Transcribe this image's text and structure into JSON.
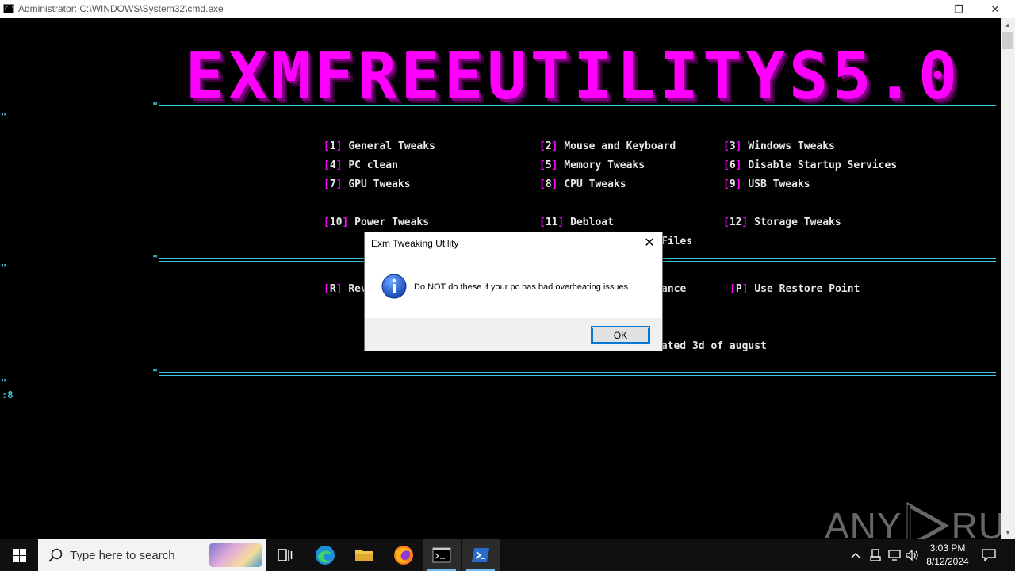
{
  "window": {
    "title": "Administrator: C:\\WINDOWS\\System32\\cmd.exe",
    "icon": "cmd-icon",
    "controls": {
      "minimize": "–",
      "restore": "❐",
      "close": "✕"
    }
  },
  "console": {
    "banner": "EXMFREEUTILITYS5.0",
    "ticks": [
      "\"",
      "\"",
      "\"",
      "\"",
      "\"",
      "\"",
      "\""
    ],
    "rows": [
      [
        {
          "key": "1",
          "label": "General Tweaks"
        },
        {
          "key": "2",
          "label": "Mouse and Keyboard"
        },
        {
          "key": "3",
          "label": "Windows Tweaks"
        }
      ],
      [
        {
          "key": "4",
          "label": "PC clean"
        },
        {
          "key": "5",
          "label": "Memory Tweaks"
        },
        {
          "key": "6",
          "label": "Disable Startup Services"
        }
      ],
      [
        {
          "key": "7",
          "label": "GPU Tweaks"
        },
        {
          "key": "8",
          "label": "CPU Tweaks"
        },
        {
          "key": "9",
          "label": "USB Tweaks"
        }
      ],
      [
        {
          "key": "10",
          "label": "Power Tweaks"
        },
        {
          "key": "11",
          "label": "Debloat"
        },
        {
          "key": "12",
          "label": "Storage Tweaks"
        }
      ]
    ],
    "partial_files": "Files",
    "bottom_row": {
      "r_key": "R",
      "r_label_partial": "Rev",
      "middle_partial": "ance",
      "p_key": "P",
      "p_label": "Use Restore Point"
    },
    "updated_partial": "dated 3d of august",
    "prompt": ":8"
  },
  "dialog": {
    "title": "Exm Tweaking Utility",
    "message": "Do NOT do these if your pc has bad overheating issues",
    "ok_label": "OK",
    "close_glyph": "✕"
  },
  "taskbar": {
    "search_placeholder": "Type here to search",
    "apps": [
      "task-view",
      "edge",
      "file-explorer",
      "firefox",
      "cmd",
      "powershell"
    ],
    "clock_time": "3:03 PM",
    "clock_date": "8/12/2024"
  },
  "watermark": {
    "left": "ANY",
    "right": "RUN"
  },
  "colors": {
    "magenta": "#ff00ff",
    "cyan": "#3cc8dc",
    "console_bg": "#000000",
    "taskbar_bg": "#101010"
  }
}
